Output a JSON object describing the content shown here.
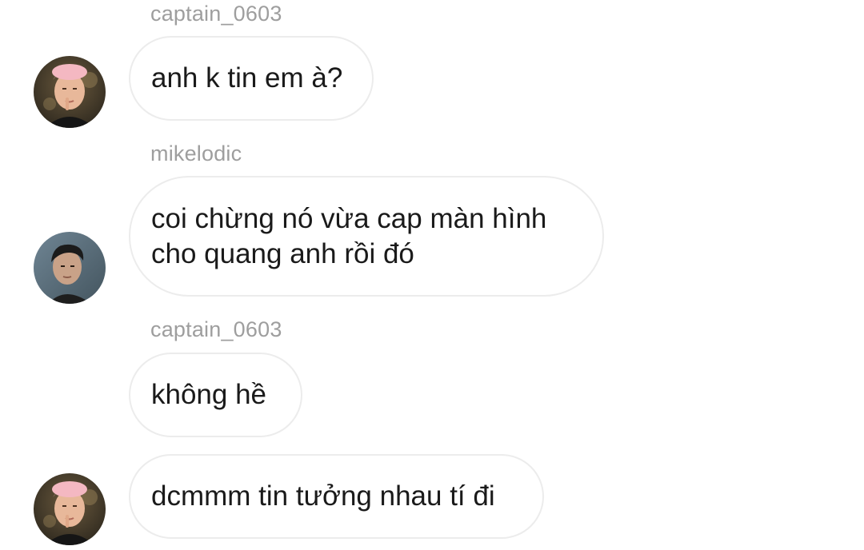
{
  "messages": [
    {
      "sender": "captain_0603",
      "text": "anh k tin em à?",
      "avatar": "captain-avatar-icon"
    },
    {
      "sender": "mikelodic",
      "lines": [
        "coi chừng nó vừa cap màn hình",
        "cho quang anh rồi đó"
      ],
      "avatar": "mikelodic-avatar-icon"
    },
    {
      "sender": "captain_0603",
      "text": "không hề"
    },
    {
      "text": "dcmmm tin tưởng nhau tí đi",
      "avatar": "captain-avatar-icon"
    }
  ],
  "colors": {
    "sender": "#9e9e9e",
    "bubble_border": "#ececec",
    "text": "#1a1a1a",
    "background": "#ffffff"
  }
}
